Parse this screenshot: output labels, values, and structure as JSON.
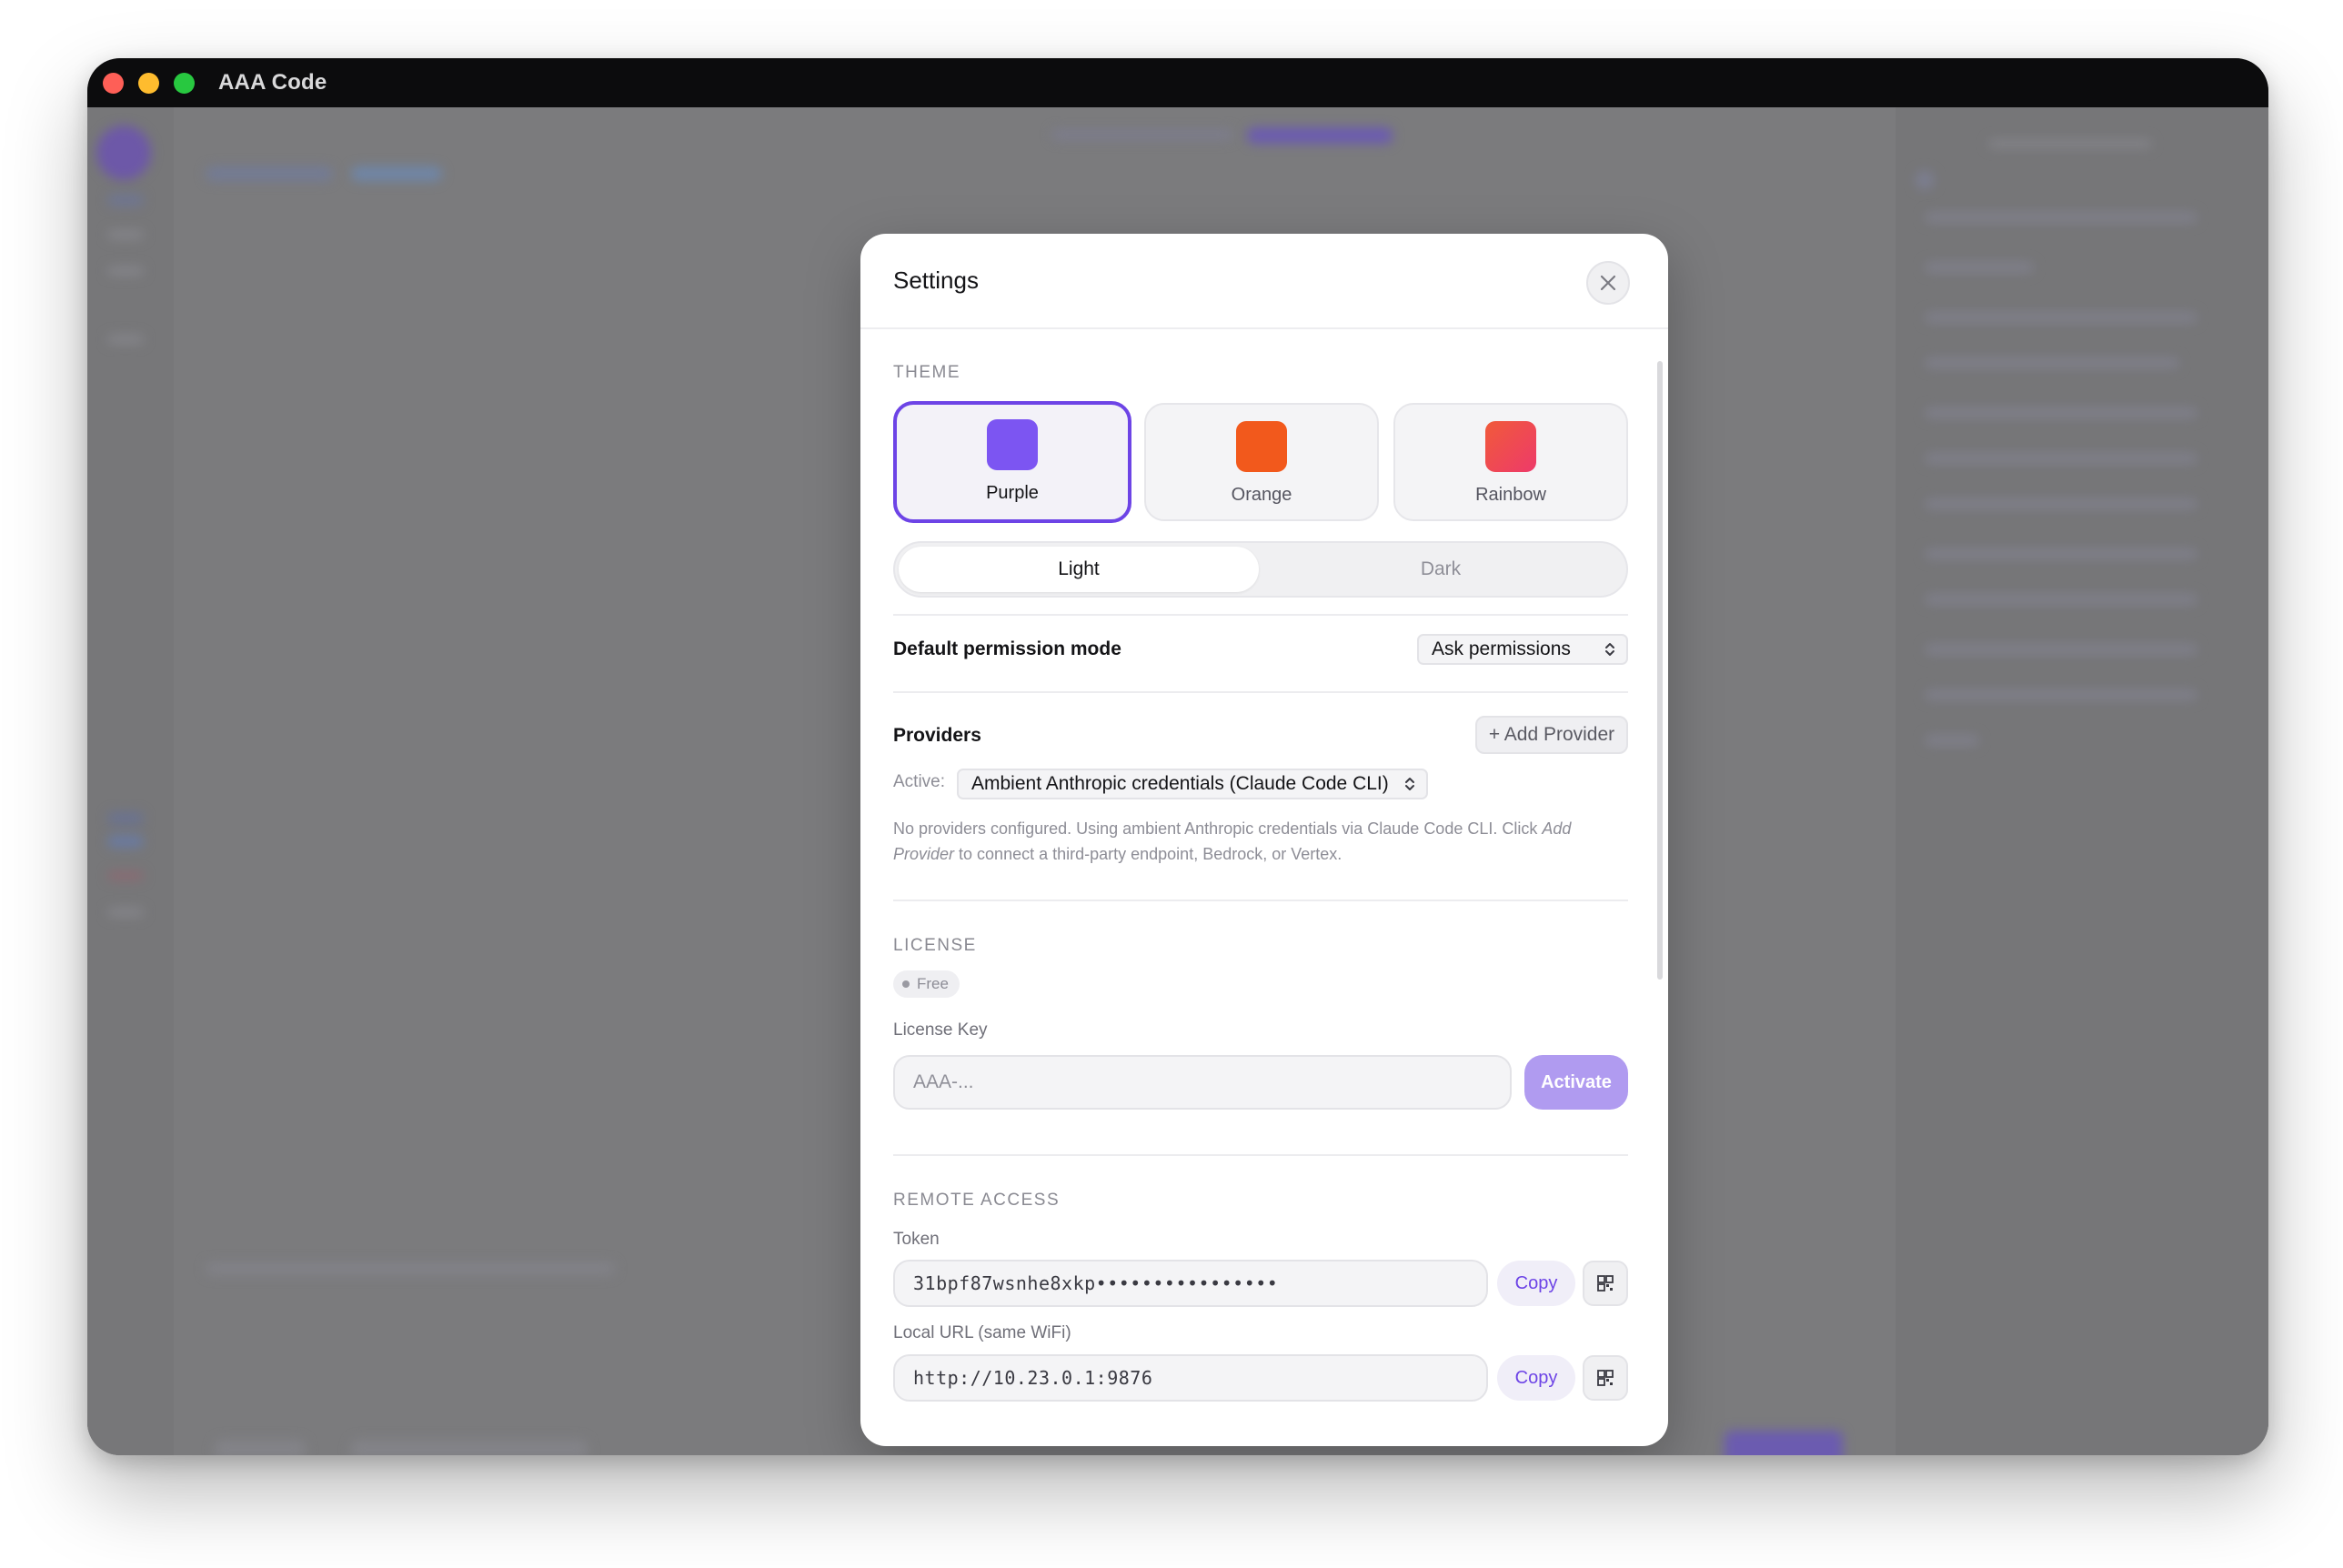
{
  "window": {
    "title": "AAA Code"
  },
  "settings": {
    "title": "Settings",
    "theme": {
      "label": "THEME",
      "options": [
        {
          "label": "Purple",
          "color": "#7c55f2",
          "selected": true
        },
        {
          "label": "Orange",
          "color": "#f2591c",
          "selected": false
        },
        {
          "label": "Rainbow",
          "color": "#f0445a",
          "selected": false
        }
      ],
      "modes": {
        "light": "Light",
        "dark": "Dark",
        "active": "Light"
      }
    },
    "permission": {
      "label": "Default permission mode",
      "value": "Ask permissions"
    },
    "providers": {
      "label": "Providers",
      "add_button": "+ Add Provider",
      "active_label": "Active:",
      "active_value": "Ambient Anthropic credentials (Claude Code CLI)",
      "note_before": "No providers configured. Using ambient Anthropic credentials via Claude Code CLI. Click ",
      "note_emphasis": "Add Provider",
      "note_after": " to connect a third-party endpoint, Bedrock, or Vertex."
    },
    "license": {
      "label": "LICENSE",
      "badge": "Free",
      "key_label": "License Key",
      "key_placeholder": "AAA-...",
      "activate_button": "Activate"
    },
    "remote_access": {
      "label": "REMOTE ACCESS",
      "token_label": "Token",
      "token_value": "31bpf87wsnhe8xkp••••••••••••••••",
      "local_url_label": "Local URL (same WiFi)",
      "local_url_value": "http://10.23.0.1:9876",
      "copy_label": "Copy"
    }
  },
  "colors": {
    "accent": "#6d44e6",
    "accent_disabled": "#b09bf0"
  }
}
